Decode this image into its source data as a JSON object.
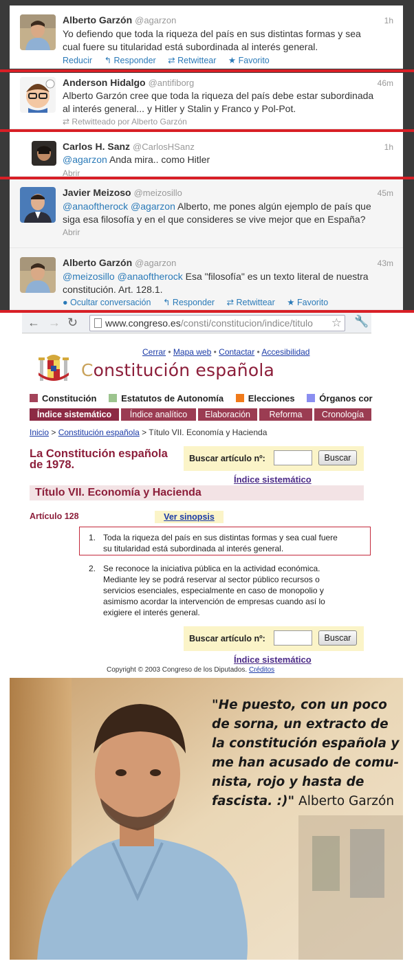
{
  "tweets": [
    {
      "name": "Alberto Garzón",
      "handle": "@agarzon",
      "time": "1h",
      "text_line1": "Yo defiendo que toda la riqueza del país en sus distintas formas y sea",
      "text_line2": "cual fuere su titularidad está subordinada al interés general.",
      "actions": {
        "reply_short": "Reducir",
        "reply": "Responder",
        "retweet": "Retwittear",
        "favorite": "Favorito"
      }
    },
    {
      "name": "Anderson Hidalgo",
      "handle": "@antifiborg",
      "time": "46m",
      "text_line1": "Alberto Garzón cree que toda la riqueza del país debe estar subordinada",
      "text_line2": "al interés general... y Hitler y Stalin y Franco y Pol-Pot.",
      "retweeted_by": "Retwitteado por Alberto Garzón"
    },
    {
      "name": "Carlos H. Sanz",
      "handle": "@CarlosHSanz",
      "time": "1h",
      "mention": "@agarzon",
      "text": "Anda mira.. como Hitler",
      "open": "Abrir"
    },
    {
      "name": "Javier Meizoso",
      "handle": "@meizosillo",
      "time": "45m",
      "mention1": "@anaoftherock",
      "mention2": "@agarzon",
      "text_line1": "Alberto, me pones algún ejemplo de país que",
      "text_line2": "siga esa filosofía y en el que consideres se vive mejor que en España?",
      "open": "Abrir"
    },
    {
      "name": "Alberto Garzón",
      "handle": "@agarzon",
      "time": "43m",
      "mention1": "@meizosillo",
      "mention2": "@anaoftherock",
      "text_line1": "Esa \"filosofía\" es un texto literal de nuestra",
      "text_line2": "constitución. Art. 128.1.",
      "actions": {
        "hide": "Ocultar conversación",
        "reply": "Responder",
        "retweet": "Retwittear",
        "favorite": "Favorito"
      }
    }
  ],
  "browser": {
    "url_host": "www.congreso.es",
    "url_path": "/consti/constitucion/indice/titulo"
  },
  "site": {
    "toplinks": [
      "Cerrar",
      "Mapa web",
      "Contactar",
      "Accesibilidad"
    ],
    "toplink_sep": "•",
    "brand_first": "C",
    "brand_rest": "onstitución española",
    "sections": [
      {
        "label": "Constitución",
        "color": "#a3435a"
      },
      {
        "label": "Estatutos de Autonomía",
        "color": "#9cc48e"
      },
      {
        "label": "Elecciones",
        "color": "#f07a1a"
      },
      {
        "label": "Órganos cor",
        "color": "#8a8ef0"
      }
    ],
    "tabs": [
      "Índice sistemático",
      "Índice analítico",
      "Elaboración",
      "Reforma",
      "Cronología"
    ],
    "breadcrumb": {
      "home": "Inicio",
      "sep": ">",
      "section": "Constitución española",
      "current": "Título VII. Economía y Hacienda"
    },
    "page_title": "La Constitución española de 1978.",
    "search_label": "Buscar artículo nº:",
    "search_button": "Buscar",
    "index_link": "Índice sistemático",
    "title_bar": "Título VII. Economía y Hacienda",
    "article": "Artículo 128",
    "sinopsis": "Ver sinopsis",
    "items": [
      {
        "n": "1.",
        "line1": "Toda la riqueza del país en sus distintas formas y sea cual fuere",
        "line2": "su titularidad está subordinada al interés general."
      },
      {
        "n": "2.",
        "line1": "Se reconoce la iniciativa pública en la actividad económica.",
        "line2": "Mediante ley se podrá reservar al sector público recursos o",
        "line3": "servicios esenciales, especialmente en caso de monopolio y",
        "line4": "asimismo acordar la intervención de empresas cuando así lo",
        "line5": "exigiere el interés general."
      }
    ],
    "copyright": "Copyright © 2003 Congreso de los Diputados.",
    "credits": "Créditos"
  },
  "quote": {
    "text": "\"He puesto, con un poco de sorna, un extracto de la constitución española y me han acusado de comu-nista, rojo y hasta de fascista. :)\"",
    "author": "Alberto Garzón"
  },
  "colors": {
    "accent_red": "#d81f26",
    "link_blue": "#2a7ab8",
    "congreso_maroon": "#8c1e3a"
  }
}
